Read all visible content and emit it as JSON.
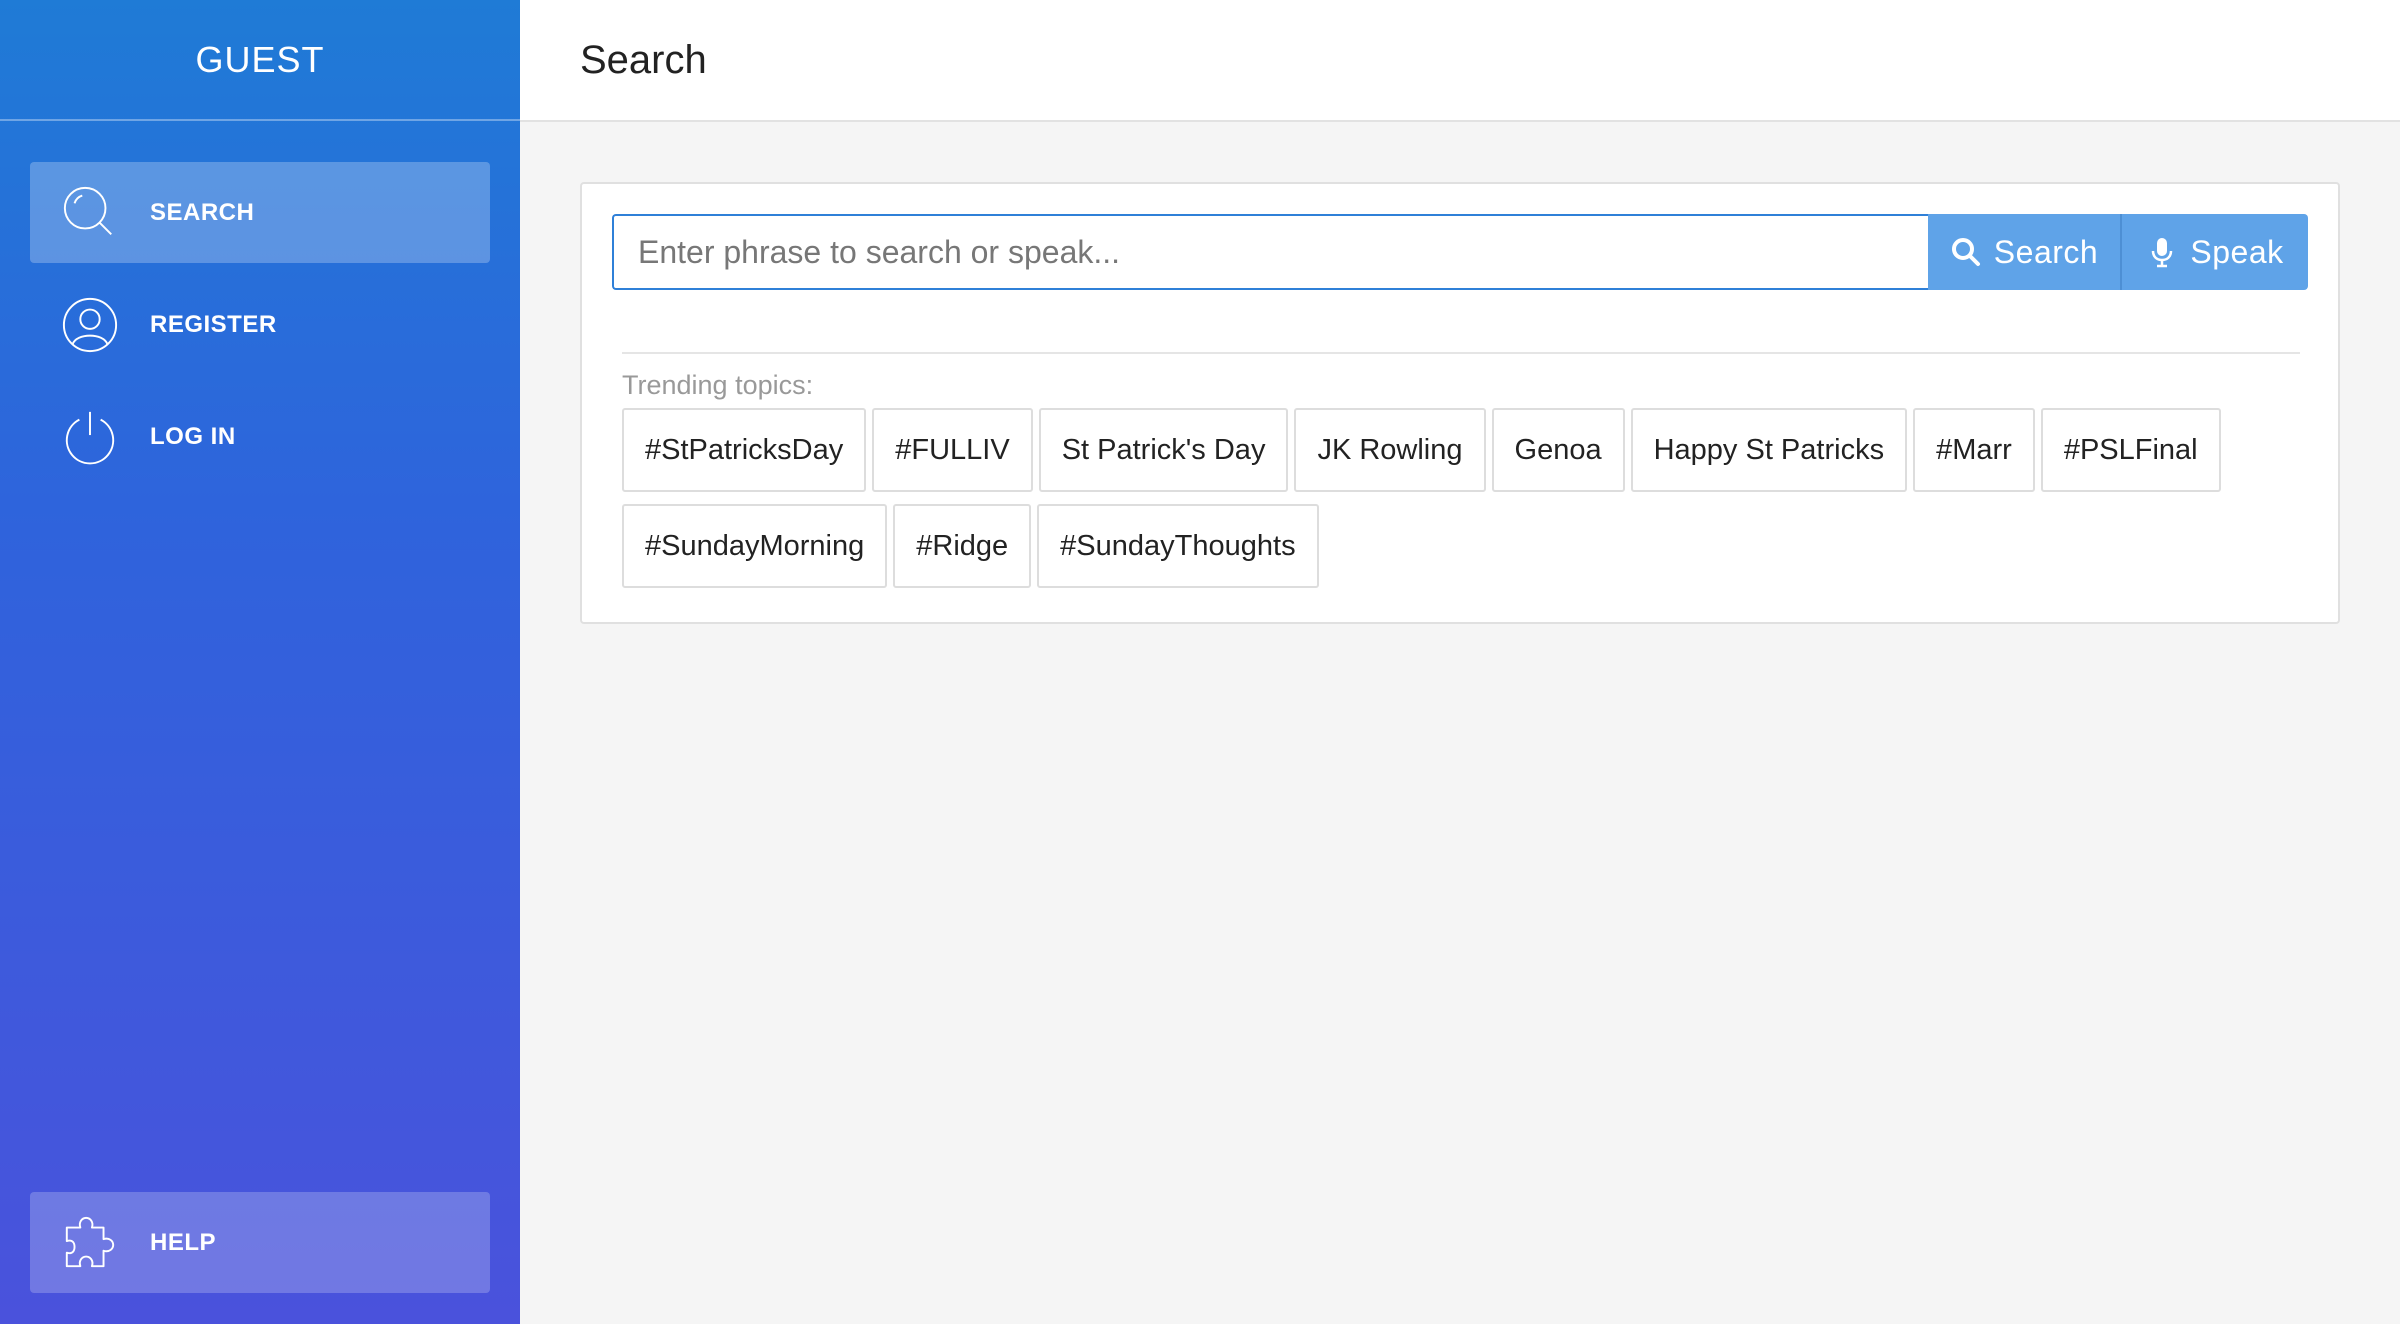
{
  "sidebar": {
    "header": "GUEST",
    "items": [
      {
        "label": "SEARCH",
        "icon": "search-icon",
        "active": true
      },
      {
        "label": "REGISTER",
        "icon": "user-icon",
        "active": false
      },
      {
        "label": "LOG IN",
        "icon": "power-icon",
        "active": false
      }
    ],
    "help": {
      "label": "HELP",
      "icon": "puzzle-icon"
    }
  },
  "main": {
    "title": "Search",
    "search": {
      "placeholder": "Enter phrase to search or speak...",
      "value": "",
      "search_button": "Search",
      "speak_button": "Speak"
    },
    "trending": {
      "label": "Trending topics:",
      "row1": [
        "#StPatricksDay",
        "#FULLIV",
        "St Patrick's Day",
        "JK Rowling",
        "Genoa",
        "Happy St Patricks",
        "#Marr",
        "#PSLFinal"
      ],
      "row2": [
        "#SundayMorning",
        "#Ridge",
        "#SundayThoughts"
      ]
    }
  },
  "colors": {
    "sidebar_top": "#1f7bd6",
    "sidebar_bottom": "#4a52dc",
    "button": "#5fa3e8",
    "input_border": "#2f80d8"
  }
}
